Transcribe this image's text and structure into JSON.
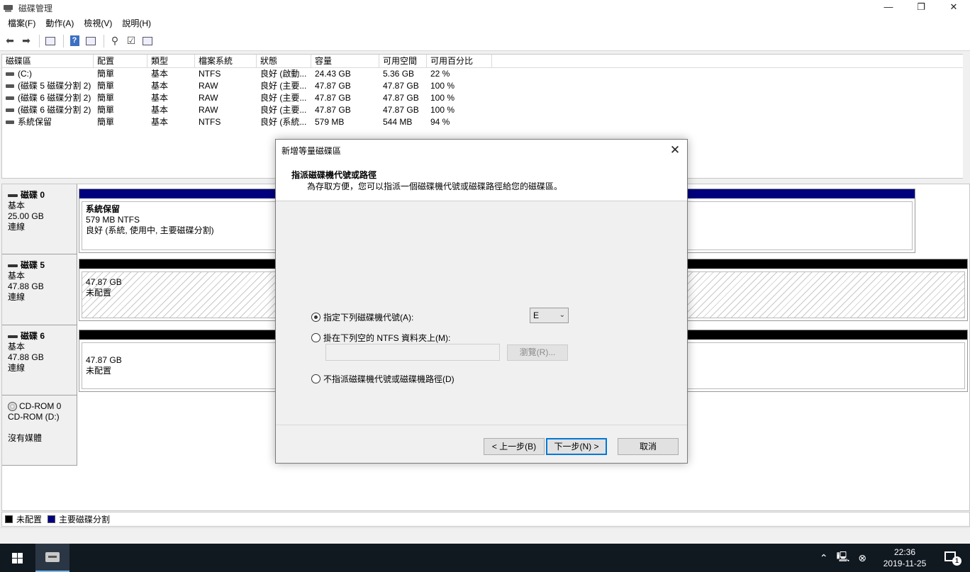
{
  "window": {
    "title": "磁碟管理",
    "minimize": "—",
    "restore": "❐",
    "close": "✕"
  },
  "menu": [
    "檔案(F)",
    "動作(A)",
    "檢視(V)",
    "說明(H)"
  ],
  "volumes": {
    "headers": [
      "磁碟區",
      "配置",
      "類型",
      "檔案系統",
      "狀態",
      "容量",
      "可用空間",
      "可用百分比"
    ],
    "rows": [
      [
        "(C:)",
        "簡單",
        "基本",
        "NTFS",
        "良好 (啟動...",
        "24.43 GB",
        "5.36 GB",
        "22 %"
      ],
      [
        "(磁碟 5 磁碟分割 2)",
        "簡單",
        "基本",
        "RAW",
        "良好 (主要...",
        "47.87 GB",
        "47.87 GB",
        "100 %"
      ],
      [
        "(磁碟 6 磁碟分割 2)",
        "簡單",
        "基本",
        "RAW",
        "良好 (主要...",
        "47.87 GB",
        "47.87 GB",
        "100 %"
      ],
      [
        "(磁碟 6 磁碟分割 2)",
        "簡單",
        "基本",
        "RAW",
        "良好 (主要...",
        "47.87 GB",
        "47.87 GB",
        "100 %"
      ],
      [
        "系統保留",
        "簡單",
        "基本",
        "NTFS",
        "良好 (系統...",
        "579 MB",
        "544 MB",
        "94 %"
      ]
    ]
  },
  "disks": [
    {
      "name": "磁碟 0",
      "type": "基本",
      "size": "25.00 GB",
      "status": "連線",
      "partition": {
        "title": "系統保留",
        "line1": "579 MB NTFS",
        "line2": "良好 (系統, 使用中, 主要磁碟分割)"
      }
    },
    {
      "name": "磁碟 5",
      "type": "基本",
      "size": "47.88 GB",
      "status": "連線",
      "partition": {
        "line1": "47.87 GB",
        "line2": "未配置"
      }
    },
    {
      "name": "磁碟 6",
      "type": "基本",
      "size": "47.88 GB",
      "status": "連線",
      "partition": {
        "line1": "47.87 GB",
        "line2": "未配置"
      }
    },
    {
      "name": "CD-ROM 0",
      "type": "CD-ROM (D:)",
      "status": "沒有媒體"
    }
  ],
  "legend": {
    "unallocated": "未配置",
    "primary": "主要磁碟分割"
  },
  "colors": {
    "unallocated": "#000000",
    "primary": "#00007f",
    "accent": "#0078d7"
  },
  "dialog": {
    "title": "新增等量磁碟區",
    "close": "✕",
    "heading": "指派磁碟機代號或路徑",
    "subheading": "為存取方便，您可以指派一個磁碟機代號或磁碟路徑給您的磁碟區。",
    "option_letter": "指定下列磁碟機代號(A):",
    "drive_letter": "E",
    "option_folder": "掛在下列空的 NTFS 資料夾上(M):",
    "browse": "瀏覽(R)...",
    "option_none": "不指派磁碟機代號或磁碟機路徑(D)",
    "back": "< 上一步(B)",
    "next": "下一步(N) >",
    "cancel": "取消"
  },
  "taskbar": {
    "time": "22:36",
    "date": "2019-11-25",
    "notifications": "1"
  }
}
